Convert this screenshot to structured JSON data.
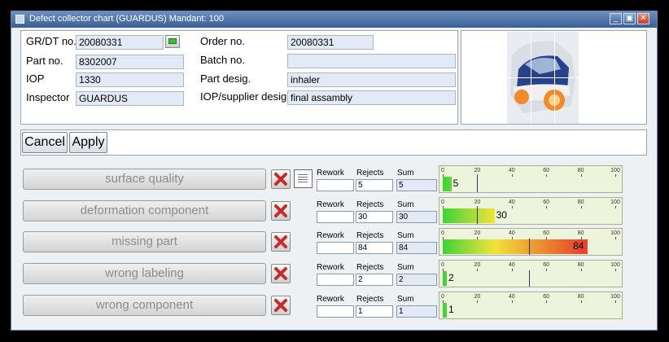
{
  "window": {
    "title": "Defect collector chart (GUARDUS) Mandant: 100",
    "controls": {
      "minimize": "_",
      "restore": "▣",
      "close": "✕"
    }
  },
  "header": {
    "grdt": {
      "label": "GR/DT no.",
      "value": "20080331"
    },
    "part_no": {
      "label": "Part no.",
      "value": "8302007"
    },
    "iop": {
      "label": "IOP",
      "value": "1330"
    },
    "inspector": {
      "label": "Inspector",
      "value": "GUARDUS"
    },
    "order_no": {
      "label": "Order no.",
      "value": "20080331"
    },
    "batch_no": {
      "label": "Batch no.",
      "value": ""
    },
    "part_desig": {
      "label": "Part desig.",
      "value": "inhaler"
    },
    "iop_supplier_desig": {
      "label": "IOP/supplier desig.",
      "value": "final assambly"
    }
  },
  "actions": {
    "cancel": "Cancel",
    "apply": "Apply"
  },
  "columns": {
    "rework": "Rework",
    "rejects": "Rejects",
    "sum": "Sum"
  },
  "gauge_ticks": [
    "0",
    "20",
    "40",
    "60",
    "80",
    "100"
  ],
  "defects": [
    {
      "name": "surface quality",
      "rework": "",
      "rework_filled": false,
      "rejects": "5",
      "sum": "5",
      "level": 5,
      "marker": 20,
      "note_icon": true
    },
    {
      "name": "deformation component",
      "rework": "",
      "rework_filled": false,
      "rejects": "30",
      "sum": "30",
      "level": 30,
      "marker": 20,
      "note_icon": false
    },
    {
      "name": "missing part",
      "rework": "",
      "rework_filled": false,
      "rejects": "84",
      "sum": "84",
      "level": 84,
      "marker": 50,
      "note_icon": false
    },
    {
      "name": "wrong labeling",
      "rework": "",
      "rework_filled": false,
      "rejects": "2",
      "sum": "2",
      "level": 2,
      "marker": 50,
      "note_icon": false
    },
    {
      "name": "wrong component",
      "rework": "",
      "rework_filled": true,
      "rejects": "1",
      "sum": "1",
      "level": 1,
      "marker": null,
      "note_icon": false
    }
  ],
  "colors": {
    "gauge_low": "#3fd23a",
    "gauge_mid": "#f1e23a",
    "gauge_high": "#e8452c",
    "rework_fill": "#1b2a9c"
  }
}
